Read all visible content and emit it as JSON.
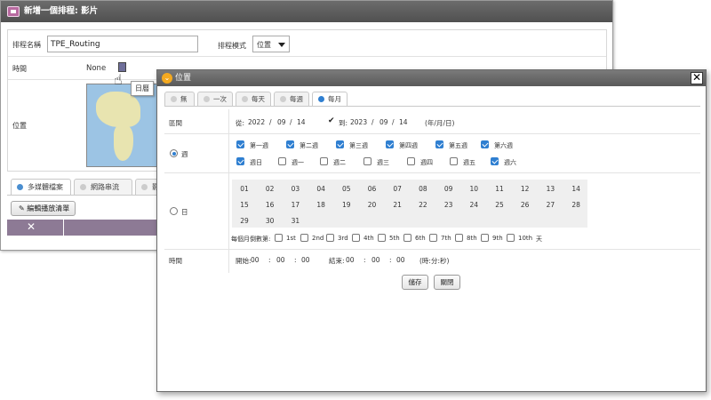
{
  "bg_window": {
    "title": "新增一個排程: 影片",
    "name_label": "排程名稱",
    "name_value": "TPE_Routing",
    "mode_label": "排程模式",
    "mode_value": "位置",
    "time_label": "時間",
    "time_value": "None",
    "tooltip": "日曆",
    "location_label": "位置",
    "tabs": [
      {
        "label": "多媒體檔案",
        "active": true
      },
      {
        "label": "網路串流",
        "active": false
      },
      {
        "label": "影",
        "active": false
      }
    ],
    "edit_button": "編輯播放清單",
    "delete_icon": "x-icon"
  },
  "dialog": {
    "title": "位置",
    "tabs": [
      {
        "label": "無",
        "active": false
      },
      {
        "label": "一次",
        "active": false
      },
      {
        "label": "每天",
        "active": false
      },
      {
        "label": "每週",
        "active": false
      },
      {
        "label": "每月",
        "active": true
      }
    ],
    "range": {
      "label": "區間",
      "from_label": "從:",
      "from_year": "2022",
      "from_month": "09",
      "from_day": "14",
      "to_label": "到:",
      "to_year": "2023",
      "to_month": "09",
      "to_day": "14",
      "format": "(年/月/日)",
      "sep": "/"
    },
    "week": {
      "radio_label": "週",
      "selected": true,
      "weeks": [
        {
          "label": "第一週",
          "checked": true
        },
        {
          "label": "第二週",
          "checked": true
        },
        {
          "label": "第三週",
          "checked": true
        },
        {
          "label": "第四週",
          "checked": true
        },
        {
          "label": "第五週",
          "checked": true
        },
        {
          "label": "第六週",
          "checked": true
        }
      ],
      "weekdays": [
        {
          "label": "週日",
          "checked": true
        },
        {
          "label": "週一",
          "checked": false
        },
        {
          "label": "週二",
          "checked": false
        },
        {
          "label": "週三",
          "checked": false
        },
        {
          "label": "週四",
          "checked": false
        },
        {
          "label": "週五",
          "checked": false
        },
        {
          "label": "週六",
          "checked": true
        }
      ]
    },
    "day": {
      "radio_label": "日",
      "selected": false,
      "days": [
        "01",
        "02",
        "03",
        "04",
        "05",
        "06",
        "07",
        "08",
        "09",
        "10",
        "11",
        "12",
        "13",
        "14",
        "15",
        "16",
        "17",
        "18",
        "19",
        "20",
        "21",
        "22",
        "23",
        "24",
        "25",
        "26",
        "27",
        "28",
        "29",
        "30",
        "31"
      ],
      "countdown_label": "每個月倒數第:",
      "countdown": [
        "1st",
        "2nd",
        "3rd",
        "4th",
        "5th",
        "6th",
        "7th",
        "8th",
        "9th",
        "10th"
      ],
      "countdown_unit": "天"
    },
    "time": {
      "label": "時間",
      "start_label": "開始:",
      "start_h": "00",
      "start_m": "00",
      "start_s": "00",
      "end_label": "結束:",
      "end_h": "00",
      "end_m": "00",
      "end_s": "00",
      "sep": ":",
      "format": "(時:分:秒)"
    },
    "save_button": "儲存",
    "close_button": "關閉"
  }
}
